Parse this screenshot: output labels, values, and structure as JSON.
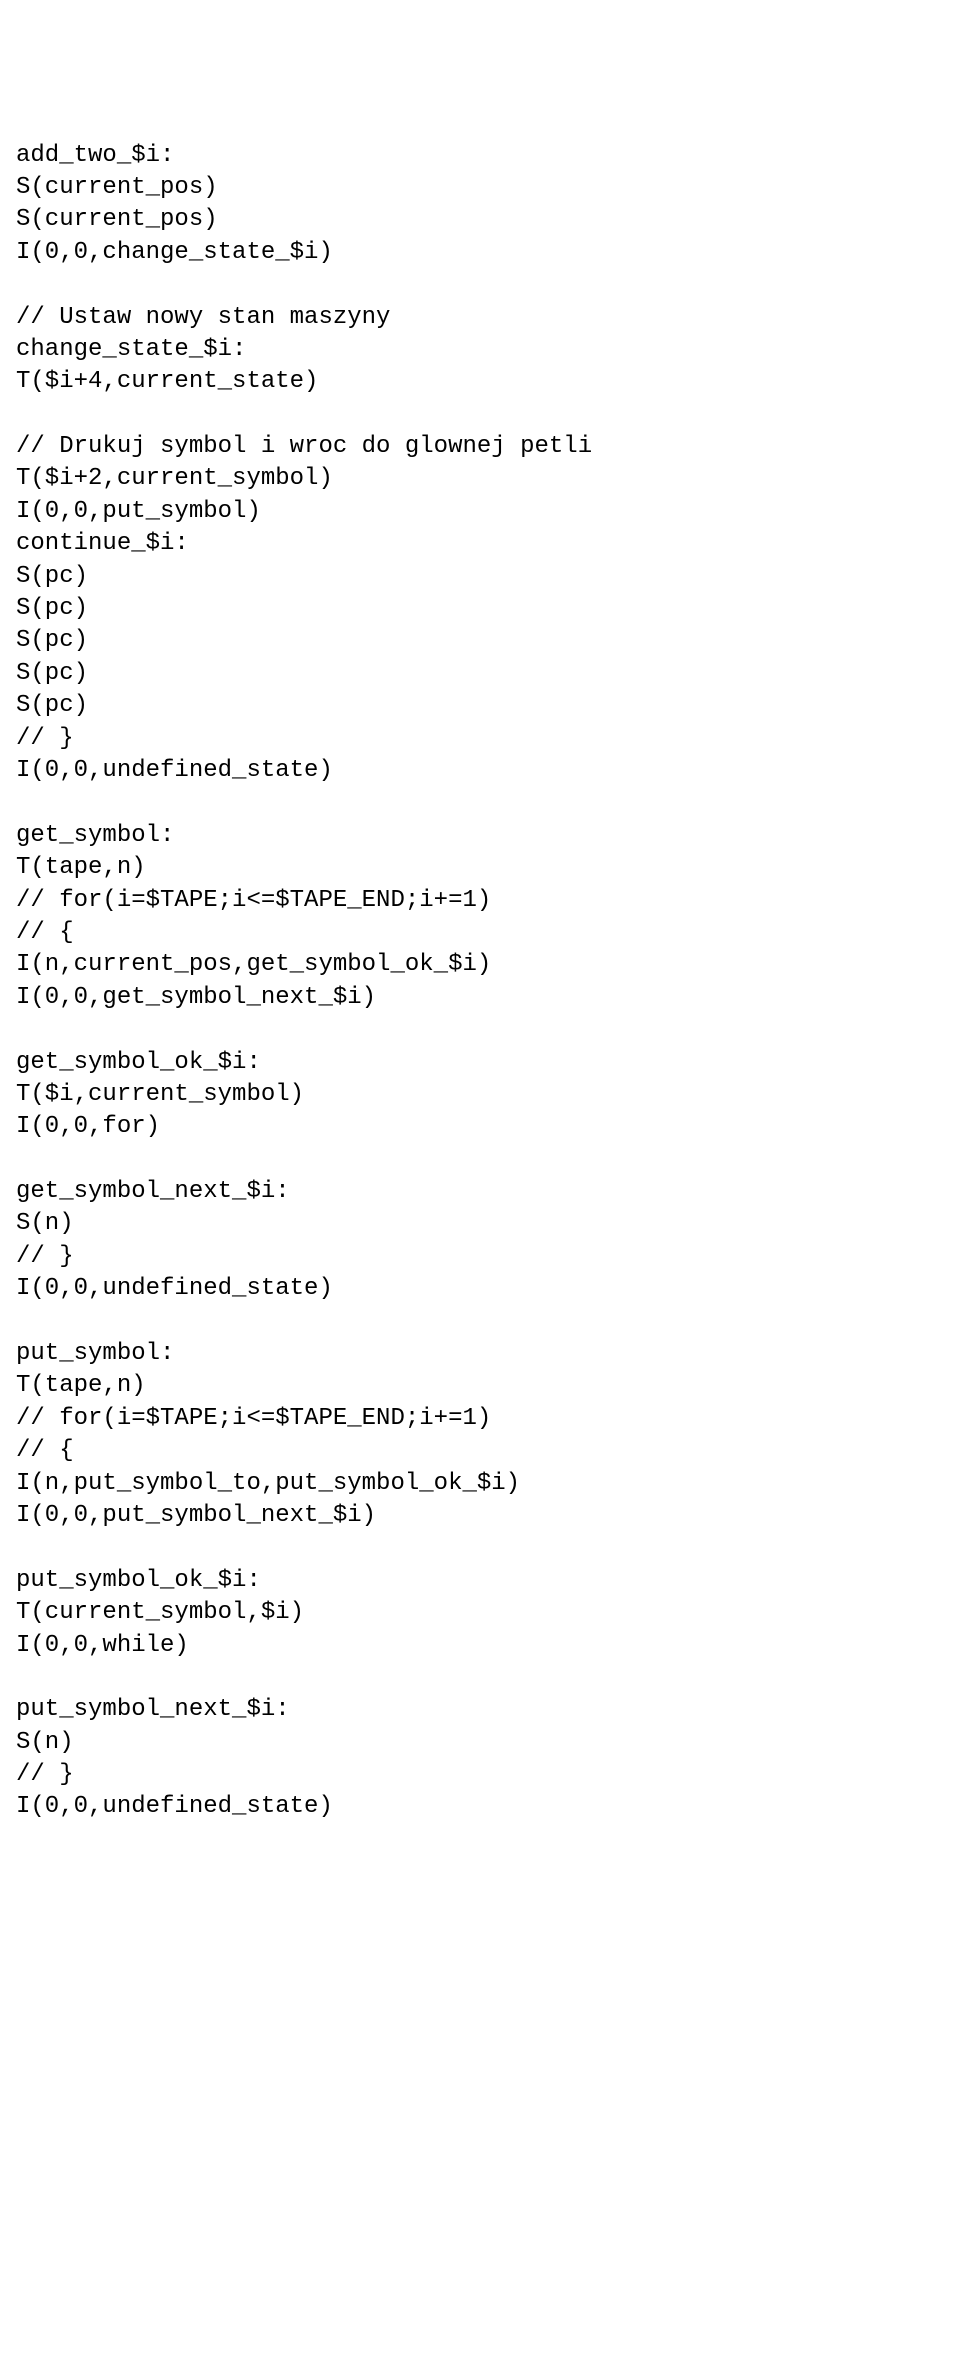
{
  "lines": [
    "add_two_$i:",
    "S(current_pos)",
    "S(current_pos)",
    "I(0,0,change_state_$i)",
    "",
    "// Ustaw nowy stan maszyny",
    "change_state_$i:",
    "T($i+4,current_state)",
    "",
    "// Drukuj symbol i wroc do glownej petli",
    "T($i+2,current_symbol)",
    "I(0,0,put_symbol)",
    "continue_$i:",
    "S(pc)",
    "S(pc)",
    "S(pc)",
    "S(pc)",
    "S(pc)",
    "// }",
    "I(0,0,undefined_state)",
    "",
    "get_symbol:",
    "T(tape,n)",
    "// for(i=$TAPE;i<=$TAPE_END;i+=1)",
    "// {",
    "I(n,current_pos,get_symbol_ok_$i)",
    "I(0,0,get_symbol_next_$i)",
    "",
    "get_symbol_ok_$i:",
    "T($i,current_symbol)",
    "I(0,0,for)",
    "",
    "get_symbol_next_$i:",
    "S(n)",
    "// }",
    "I(0,0,undefined_state)",
    "",
    "put_symbol:",
    "T(tape,n)",
    "// for(i=$TAPE;i<=$TAPE_END;i+=1)",
    "// {",
    "I(n,put_symbol_to,put_symbol_ok_$i)",
    "I(0,0,put_symbol_next_$i)",
    "",
    "put_symbol_ok_$i:",
    "T(current_symbol,$i)",
    "I(0,0,while)",
    "",
    "put_symbol_next_$i:",
    "S(n)",
    "// }",
    "I(0,0,undefined_state)"
  ]
}
